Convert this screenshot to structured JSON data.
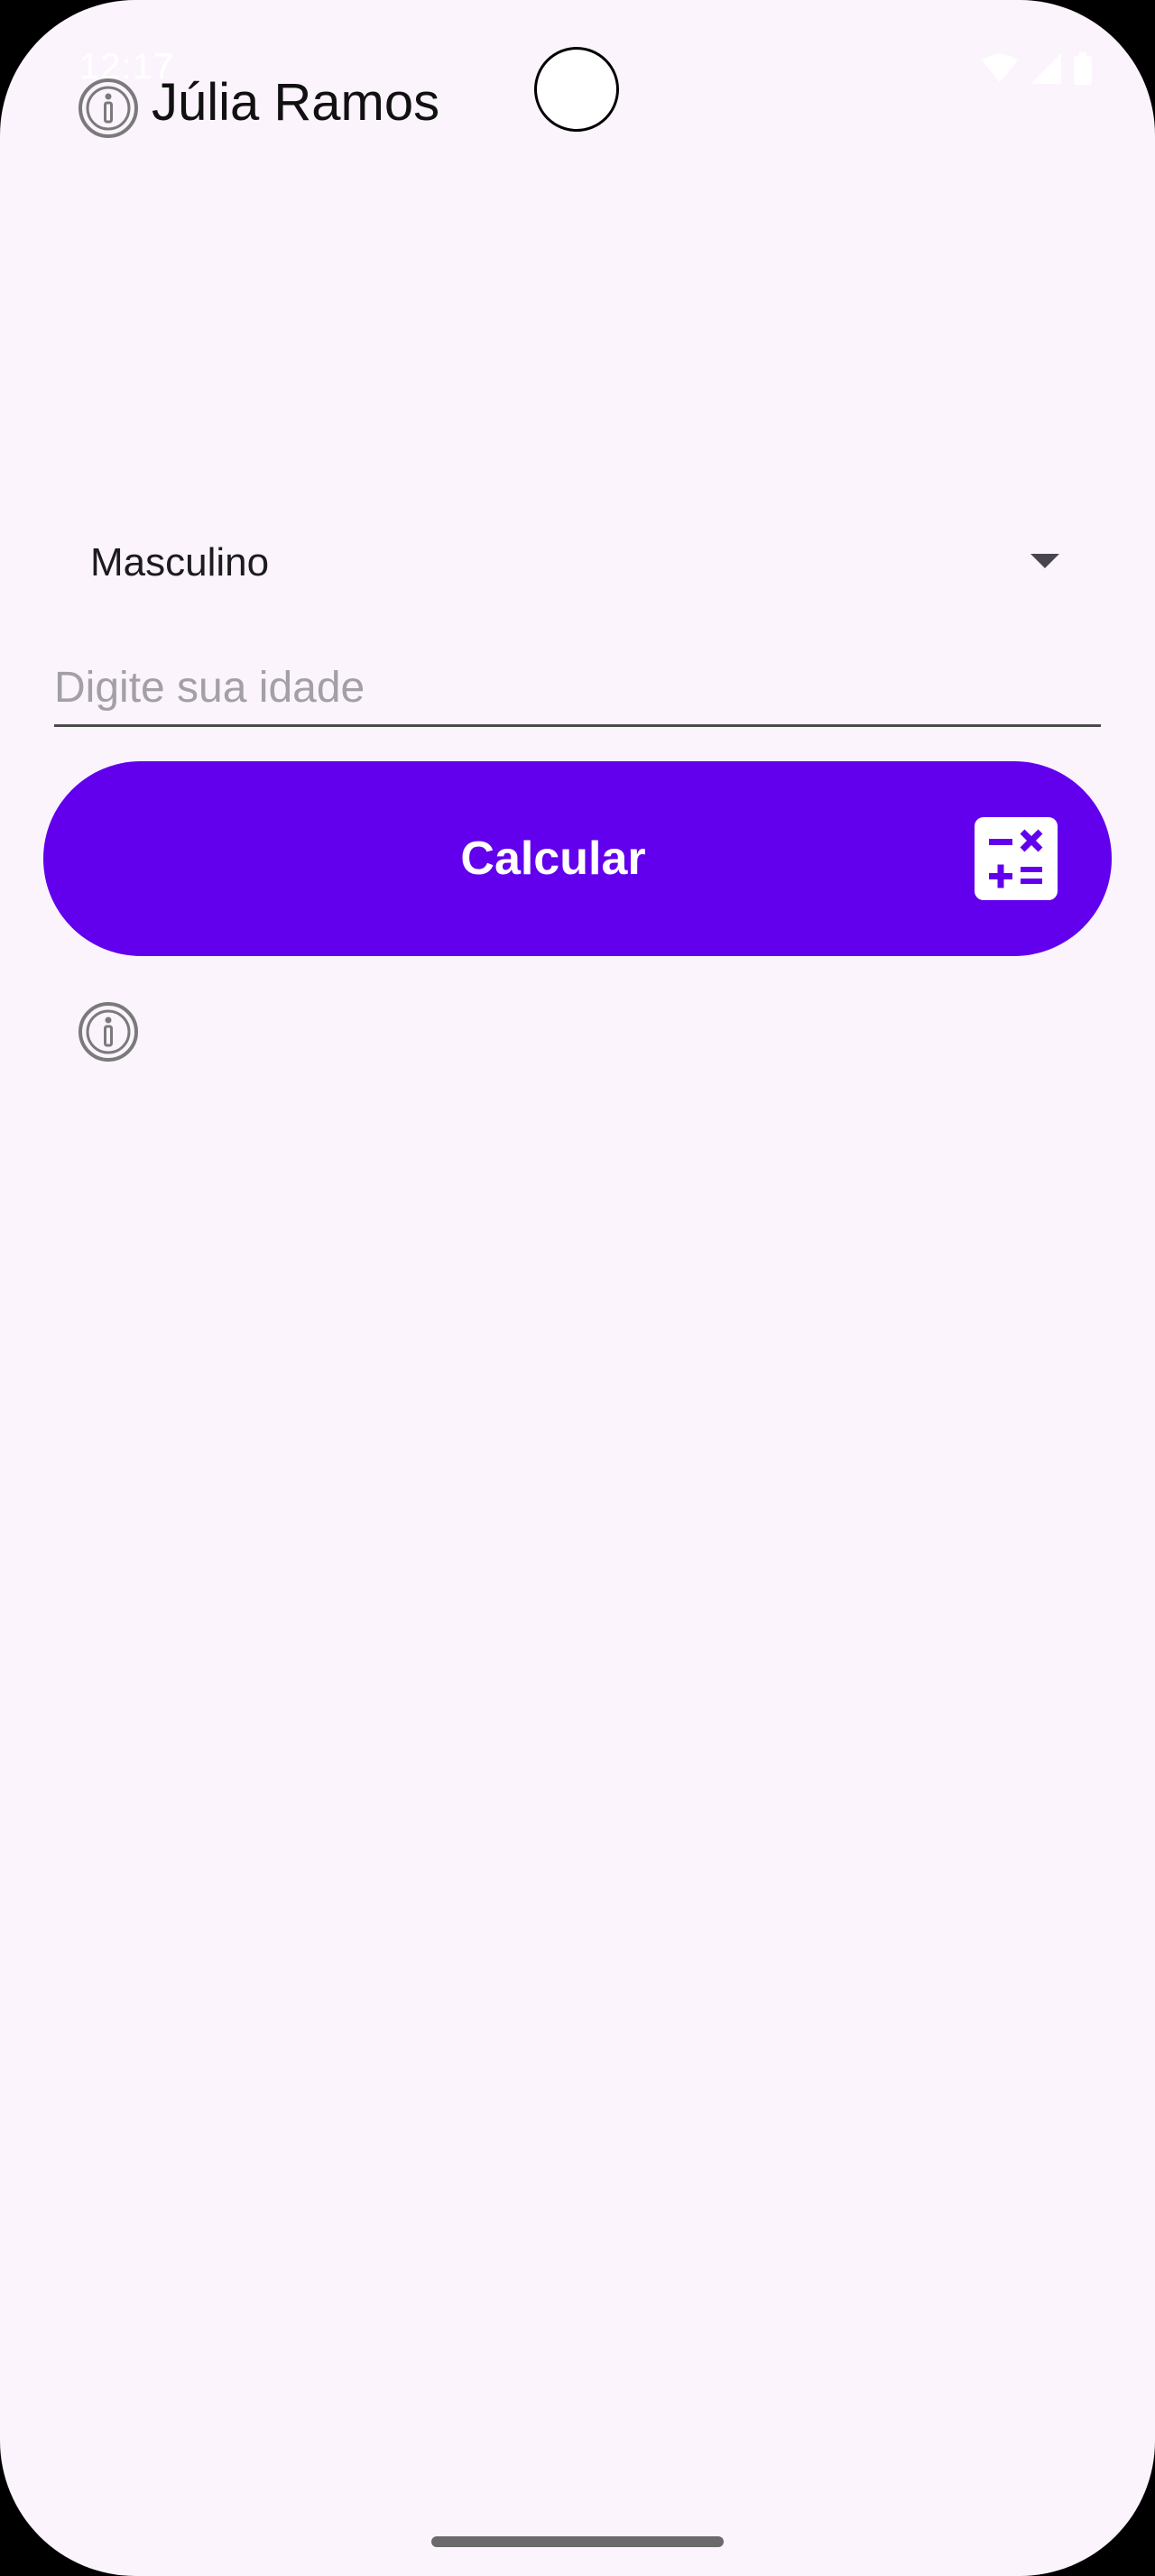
{
  "status_bar": {
    "time": "12:17",
    "icons": [
      "wifi-icon",
      "signal-icon",
      "battery-icon"
    ]
  },
  "header": {
    "icon": "info-icon",
    "title": "Júlia Ramos"
  },
  "form": {
    "gender_select": {
      "selected": "Masculino"
    },
    "age_input": {
      "value": "",
      "placeholder": "Digite sua idade"
    },
    "calculate_button": {
      "label": "Calcular",
      "icon": "calculator-icon"
    }
  },
  "result": {
    "icon": "info-icon"
  },
  "colors": {
    "background": "#FCF4FC",
    "primary": "#6200EE",
    "on_primary": "#FFFFFF"
  }
}
